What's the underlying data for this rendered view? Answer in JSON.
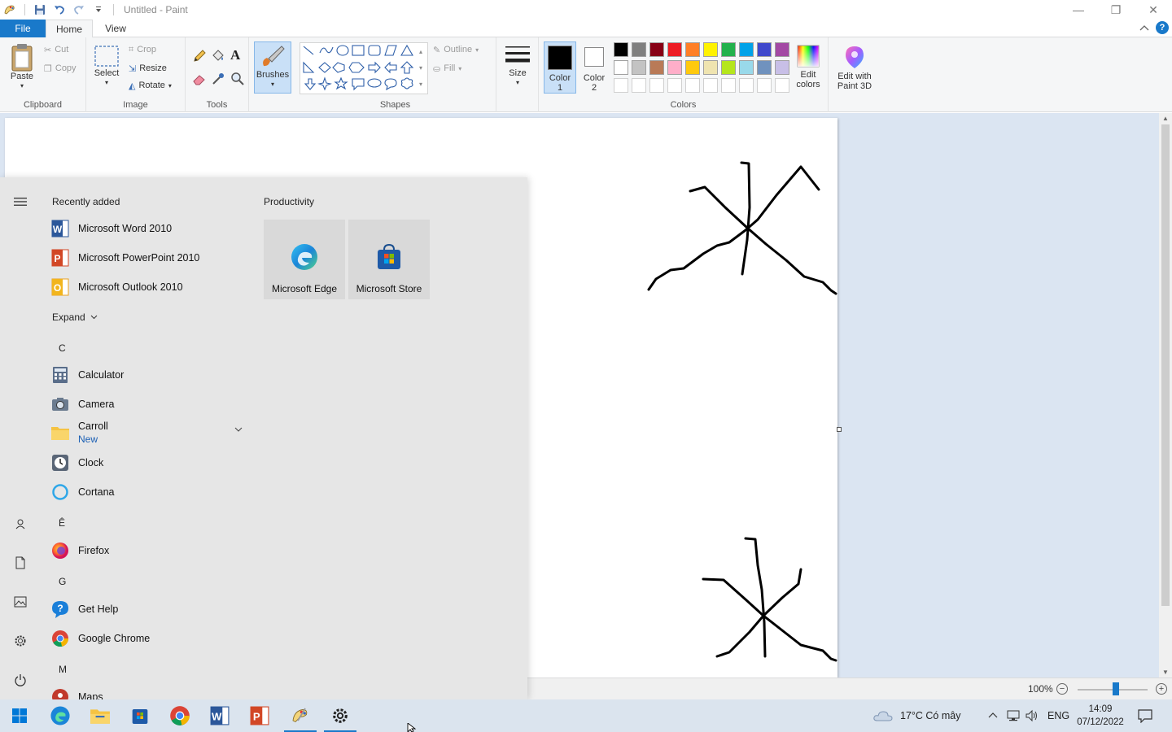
{
  "window": {
    "title": "Untitled - Paint",
    "controls": {
      "minimize": "—",
      "restore": "❐",
      "close": "✕"
    }
  },
  "ribbon": {
    "tabs": [
      {
        "label": "File"
      },
      {
        "label": "Home"
      },
      {
        "label": "View"
      }
    ],
    "clipboard": {
      "label": "Clipboard",
      "paste": "Paste",
      "cut": "Cut",
      "copy": "Copy"
    },
    "image": {
      "label": "Image",
      "select": "Select",
      "crop": "Crop",
      "resize": "Resize",
      "rotate": "Rotate"
    },
    "tools": {
      "label": "Tools"
    },
    "brushes": {
      "label": "Brushes"
    },
    "shapes": {
      "label": "Shapes",
      "outline": "Outline",
      "fill": "Fill"
    },
    "size": {
      "label": "Size"
    },
    "colors": {
      "label": "Colors",
      "color1_line1": "Color",
      "color1_line2": "1",
      "color2_line1": "Color",
      "color2_line2": "2",
      "edit_line1": "Edit",
      "edit_line2": "colors",
      "paint3d_line1": "Edit with",
      "paint3d_line2": "Paint 3D",
      "color1_value": "#000000",
      "color2_value": "#ffffff",
      "palette_row1": [
        "#000000",
        "#7f7f7f",
        "#880015",
        "#ed1c24",
        "#ff7f27",
        "#fff200",
        "#22b14c",
        "#00a2e8",
        "#3f48cc",
        "#a349a4"
      ],
      "palette_row2": [
        "#ffffff",
        "#c3c3c3",
        "#b97a57",
        "#ffaec9",
        "#ffc90e",
        "#efe4b0",
        "#b5e61d",
        "#99d9ea",
        "#7092be",
        "#c8bfe7"
      ]
    }
  },
  "status": {
    "zoom": "100%",
    "zoom_level": 0.55
  },
  "start_menu": {
    "recently_added_label": "Recently added",
    "recent": [
      {
        "name": "Microsoft Word 2010",
        "icon": "word-icon"
      },
      {
        "name": "Microsoft PowerPoint 2010",
        "icon": "powerpoint-icon"
      },
      {
        "name": "Microsoft Outlook 2010",
        "icon": "outlook-icon"
      }
    ],
    "expand_label": "Expand",
    "letters": {
      "c": "C",
      "e": "Ê",
      "g": "G",
      "m": "M"
    },
    "apps": {
      "calculator": "Calculator",
      "camera": "Camera",
      "carroll": "Carroll",
      "carroll_sub": "New",
      "clock": "Clock",
      "cortana": "Cortana",
      "firefox": "Firefox",
      "get_help": "Get Help",
      "chrome": "Google Chrome",
      "maps": "Maps"
    },
    "productivity_label": "Productivity",
    "tiles": [
      {
        "name": "Microsoft Edge"
      },
      {
        "name": "Microsoft Store"
      }
    ]
  },
  "taskbar": {
    "weather": "17°C  Có mây",
    "language": "ENG",
    "time": "14:09",
    "date": "07/12/2022"
  }
}
